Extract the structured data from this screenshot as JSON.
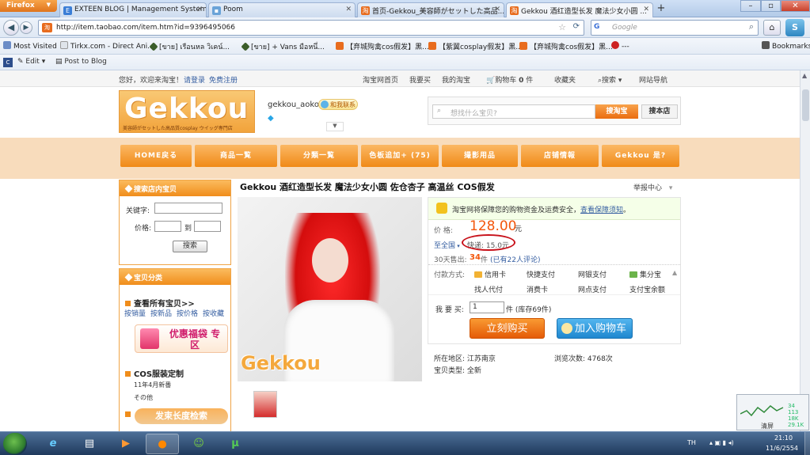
{
  "browser": {
    "app_button": "Firefox",
    "tabs": [
      {
        "label": "EXTEEN BLOG | Management System",
        "icon": "exteen-icon"
      },
      {
        "label": "Poom",
        "icon": "page-icon"
      },
      {
        "label": "首页-Gekkou_美容師がセットした高品...",
        "icon": "taobao-icon"
      },
      {
        "label": "Gekkou 酒红造型长发 魔法少女小圆 ...",
        "icon": "taobao-icon"
      }
    ],
    "url": "http://item.taobao.com/item.htm?id=9396495066",
    "search_placeholder": "Google",
    "bookmarks": [
      "Most Visited",
      "Tirkx.com - Direct Ani...",
      "[ขาย] เรือนหล วิเคน์...",
      "[ขาย] + Vans มือหนึ่...",
      "【弃城殉禽cos假发】黑...",
      "【紫翼cosplay假发】黑...",
      "【弃城殉禽cos假发】黑...",
      "---"
    ],
    "bookmarks_menu": "Bookmarks",
    "toolbar3": {
      "edit": "Edit",
      "post": "Post to Blog"
    }
  },
  "taobao_top": {
    "greeting": "您好，欢迎来淘宝！",
    "login": "请登录",
    "register": "免费注册",
    "links": [
      "淘宝网首页",
      "我要买",
      "我的淘宝",
      "购物车",
      "0",
      "件",
      "收藏夹",
      "搜索",
      "网站导航"
    ]
  },
  "shop": {
    "logo_text": "Gekkou",
    "logo_sub": "美容師がセットした高品質cosplay ウイッグ専門店",
    "name": "gekkou_aoko",
    "contact": "和我联系",
    "search_placeholder": "想找什么宝贝?",
    "search_taobao": "搜淘宝",
    "search_store": "搜本店",
    "nav": [
      "HOME戻る",
      "商品一覧",
      "分類一覧",
      "色板追加+ (75)",
      "撮影用品",
      "店铺情報",
      "Gekkou 是?"
    ]
  },
  "sidebar": {
    "search_title": "搜索店内宝贝",
    "keyword_label": "关键字:",
    "price_label": "价格:",
    "to": "到",
    "search_btn": "搜索",
    "cat_title": "宝贝分类",
    "all": "查看所有宝贝>>",
    "sort_links": [
      "按销量",
      "按新品",
      "按价格",
      "按收藏"
    ],
    "promo": "优惠福袋 专区",
    "cos_title": "COS服装定制",
    "cos_items": [
      "11年4月新番",
      "その他"
    ],
    "banner2": "发束长度检索"
  },
  "product": {
    "title": "Gekkou 酒红造型长发 魔法少女小圆 佐仓杏子 高温丝 COS假发",
    "report": "举报中心",
    "guarantee": "淘宝网将保障您的购物资金及运费安全，",
    "guarantee_link": "查看保障须知",
    "price_label": "价    格:",
    "price": "128.00",
    "yuan": "元",
    "ship_to": "至全国",
    "ship": "快递: 15.0元",
    "sold_pre": "30天售出:",
    "sold": "34",
    "sold_post": "件",
    "reviews": "(已有22人评论)",
    "pay_label": "付款方式:",
    "pay_methods": [
      "信用卡",
      "快捷支付",
      "网银支付",
      "集分宝",
      "找人代付",
      "消费卡",
      "网点支付",
      "支付宝余额"
    ],
    "qty_label": "我 要 买:",
    "qty": "1",
    "stock": "件 (库存69件)",
    "buy_now": "立刻购买",
    "add_cart": "加入购物车",
    "location": "所在地区: 江苏南京",
    "views": "浏览次数: 4768次",
    "condition": "宝贝类型: 全新",
    "watermark": "Gekkou"
  },
  "taskbar": {
    "lang": "TH",
    "time": "21:10",
    "date": "11/6/2554"
  },
  "widget": {
    "values": [
      "34",
      "113",
      "18K",
      "29.1K"
    ],
    "label": "清屏"
  },
  "colors": {
    "taobao_orange": "#f08d1b",
    "price": "#f3560c",
    "circle": "#c8121b"
  }
}
